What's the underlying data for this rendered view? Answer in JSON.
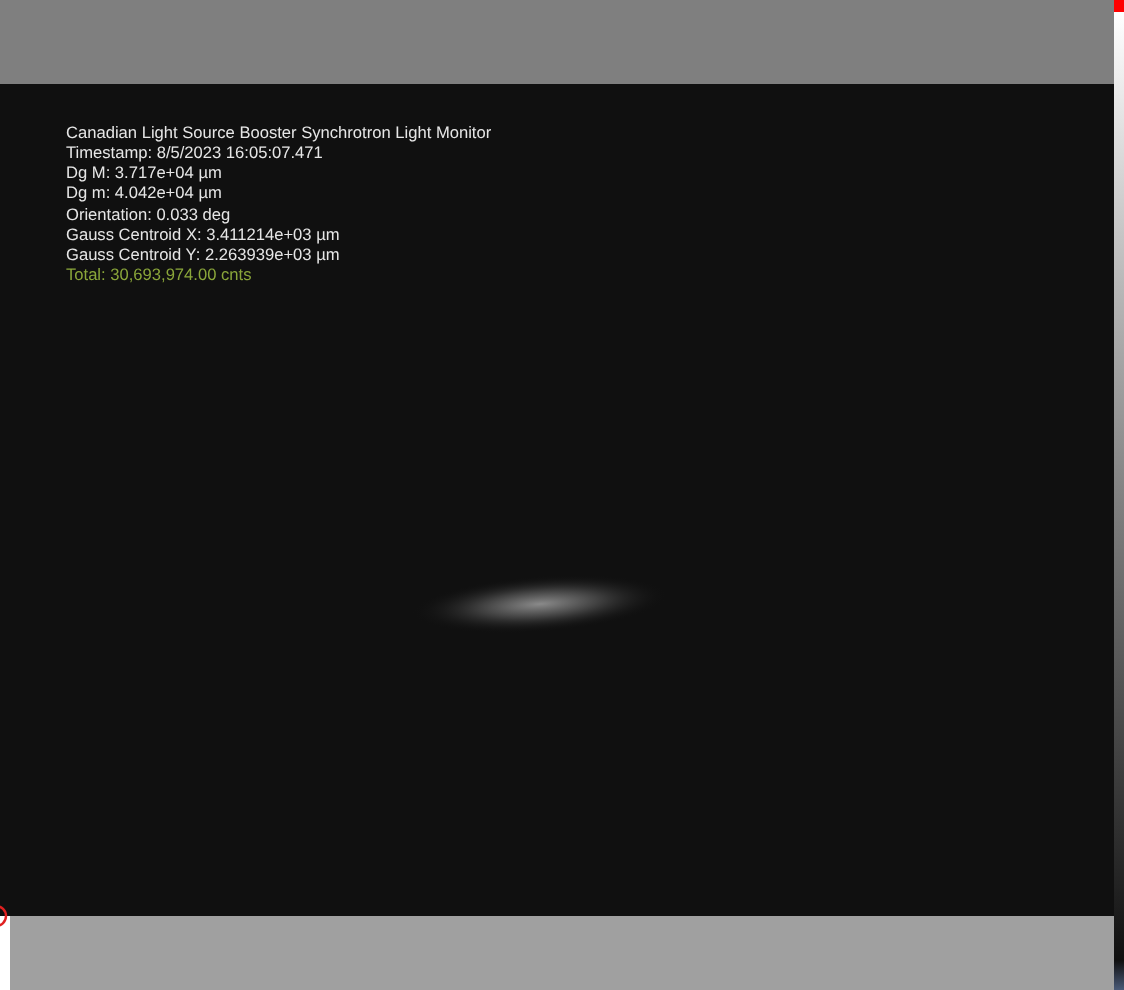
{
  "overlay": {
    "lines": [
      {
        "text": "Canadian Light Source Booster Synchrotron Light Monitor",
        "kind": "info"
      },
      {
        "text": "Timestamp: 8/5/2023 16:05:07.471",
        "kind": "info"
      },
      {
        "text": "Dg M: 3.717e+04 µm",
        "kind": "info"
      },
      {
        "text": "Dg m: 4.042e+04 µm",
        "kind": "info"
      },
      {
        "text": "Orientation: 0.033 deg",
        "kind": "info"
      },
      {
        "text": "Gauss Centroid X: 3.411214e+03 µm",
        "kind": "info"
      },
      {
        "text": "Gauss Centroid Y: 2.263939e+03 µm",
        "kind": "info"
      },
      {
        "text": "Total: 30,693,974.00 cnts",
        "kind": "total"
      }
    ]
  }
}
